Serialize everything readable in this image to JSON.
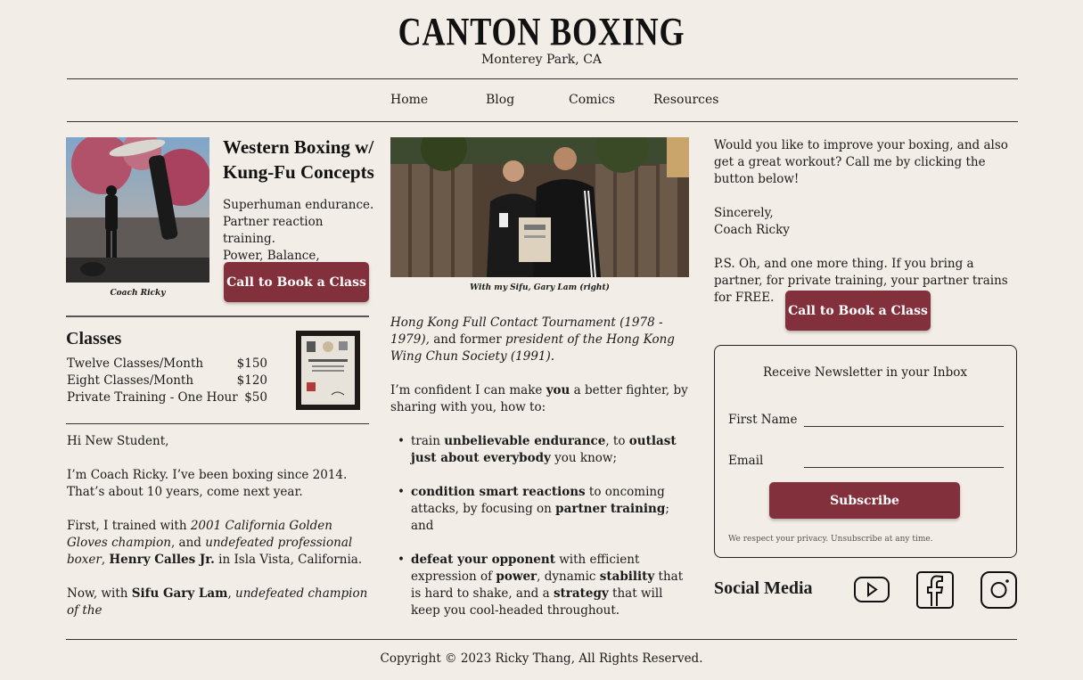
{
  "site": {
    "title": "CANTON BOXING",
    "location": "Monterey Park, CA"
  },
  "nav": {
    "items": [
      "Home",
      "Blog",
      "Comics",
      "Resources"
    ]
  },
  "hero": {
    "coach_caption": "Coach Ricky",
    "headline_line1": "Western Boxing w/",
    "headline_line2": "Kung-Fu Concepts",
    "tagline": [
      "Superhuman endurance.",
      "Partner reaction training.",
      "Power, Balance, Strategy."
    ],
    "cta_label": "Call to Book a Class"
  },
  "classes": {
    "title": "Classes",
    "rows": [
      {
        "name": "Twelve Classes/Month",
        "price": "$150"
      },
      {
        "name": "Eight Classes/Month",
        "price": "$120"
      },
      {
        "name": "Private Training - One Hour",
        "price": "$50"
      }
    ]
  },
  "letter_left": {
    "greeting": "Hi New Student,",
    "p1": "I’m Coach Ricky. I’ve been boxing since 2014. That’s about 10 years, come next year.",
    "p2_a": "First, I trained with ",
    "p2_b": "2001 California Golden Gloves champion",
    "p2_c": ", and ",
    "p2_d": "undefeated professional boxer",
    "p2_e": ", ",
    "p2_f": "Henry Calles Jr.",
    "p2_g": " in Isla Vista, California.",
    "p3_a": "Now, with ",
    "p3_b": "Sifu Gary Lam",
    "p3_c": ", ",
    "p3_d": "undefeated champion of the"
  },
  "center": {
    "photo_caption": "With my Sifu, Gary Lam (right)",
    "p1_a": "Hong Kong Full Contact Tournament (1978 - 1979),",
    "p1_b": " and former ",
    "p1_c": "president of the Hong Kong Wing Chun Society (1991).",
    "p2_a": "I’m confident I can make ",
    "p2_b": "you",
    "p2_c": " a better fighter, by sharing with you, how to:",
    "b1_a": "train ",
    "b1_b": "unbelievable endurance",
    "b1_c": ", to ",
    "b1_d": "outlast just about everybody",
    "b1_e": " you know;",
    "b2_a": "condition smart reactions",
    "b2_b": " to oncoming attacks, by focusing on ",
    "b2_c": "partner training",
    "b2_d": "; and",
    "b3_a": "defeat your opponent",
    "b3_b": " with efficient expression of ",
    "b3_c": "power",
    "b3_d": ", dynamic ",
    "b3_e": "stability",
    "b3_f": " that is hard to shake, and a ",
    "b3_g": "strategy",
    "b3_h": " that will keep you cool-headed throughout."
  },
  "right": {
    "p1": "Would you like to improve your boxing, and also get a great workout? Call me by clicking the button below!",
    "sign1": "Sincerely,",
    "sign2": "Coach Ricky",
    "ps": "P.S. Oh, and one more thing. If you bring a partner, for private training, your partner trains for FREE.",
    "cta_label": "Call to Book a Class"
  },
  "newsletter": {
    "title": "Receive Newsletter in your Inbox",
    "first_name_label": "First Name",
    "email_label": "Email",
    "subscribe_label": "Subscribe",
    "privacy": "We respect your privacy. Unsubscribe at any time."
  },
  "social": {
    "title": "Social Media",
    "icons": [
      "youtube-icon",
      "facebook-icon",
      "instagram-icon"
    ]
  },
  "footer": {
    "copyright": "Copyright © 2023 Ricky Thang, All Rights Reserved."
  },
  "colors": {
    "background": "#f2ede6",
    "accent": "#83303d"
  }
}
